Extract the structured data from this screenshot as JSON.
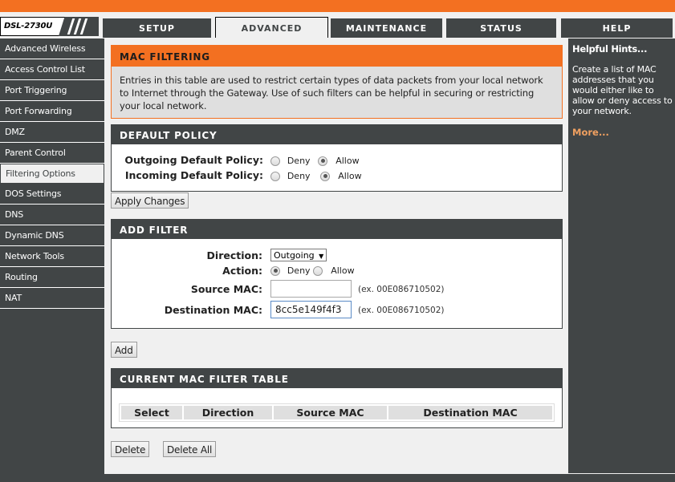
{
  "header": {
    "model": "DSL-2730U",
    "brand_color": "#f37021",
    "dark_color": "#414546"
  },
  "tabs": [
    {
      "label": "SETUP",
      "active": false
    },
    {
      "label": "ADVANCED",
      "active": true
    },
    {
      "label": "MAINTENANCE",
      "active": false
    },
    {
      "label": "STATUS",
      "active": false
    },
    {
      "label": "HELP",
      "active": false
    }
  ],
  "sidebar": {
    "items": [
      {
        "label": "Advanced Wireless",
        "active": false
      },
      {
        "label": "Access Control List",
        "active": false
      },
      {
        "label": "Port Triggering",
        "active": false
      },
      {
        "label": "Port Forwarding",
        "active": false
      },
      {
        "label": "DMZ",
        "active": false
      },
      {
        "label": "Parent Control",
        "active": false
      },
      {
        "label": "Filtering Options",
        "active": true
      },
      {
        "label": "DOS Settings",
        "active": false
      },
      {
        "label": "DNS",
        "active": false
      },
      {
        "label": "Dynamic DNS",
        "active": false
      },
      {
        "label": "Network Tools",
        "active": false
      },
      {
        "label": "Routing",
        "active": false
      },
      {
        "label": "NAT",
        "active": false
      }
    ]
  },
  "intro": {
    "title": "MAC FILTERING",
    "text": "Entries in this table are used to restrict certain types of data packets from your local network to Internet through the Gateway. Use of such filters can be helpful in securing or restricting your local network."
  },
  "default_policy": {
    "title": "DEFAULT POLICY",
    "outgoing_label": "Outgoing Default Policy:",
    "incoming_label": "Incoming Default Policy:",
    "deny_label": "Deny",
    "allow_label": "Allow",
    "outgoing_value": "Allow",
    "incoming_value": "Allow",
    "apply_button": "Apply Changes"
  },
  "add_filter": {
    "title": "ADD FILTER",
    "direction_label": "Direction:",
    "direction_value": "Outgoing",
    "action_label": "Action:",
    "action_value": "Deny",
    "deny_label": "Deny",
    "allow_label": "Allow",
    "source_label": "Source MAC:",
    "source_value": "",
    "dest_label": "Destination MAC:",
    "dest_value": "8cc5e149f4f3",
    "example_hint": "(ex. 00E086710502)",
    "add_button": "Add"
  },
  "mac_table": {
    "title": "CURRENT MAC FILTER TABLE",
    "columns": [
      "Select",
      "Direction",
      "Source MAC",
      "Destination MAC"
    ],
    "rows": [],
    "delete_button": "Delete",
    "delete_all_button": "Delete All"
  },
  "help": {
    "title": "Helpful Hints...",
    "text": "Create a list of MAC addresses that you would either like to allow or deny access to your network.",
    "more_link": "More..."
  }
}
